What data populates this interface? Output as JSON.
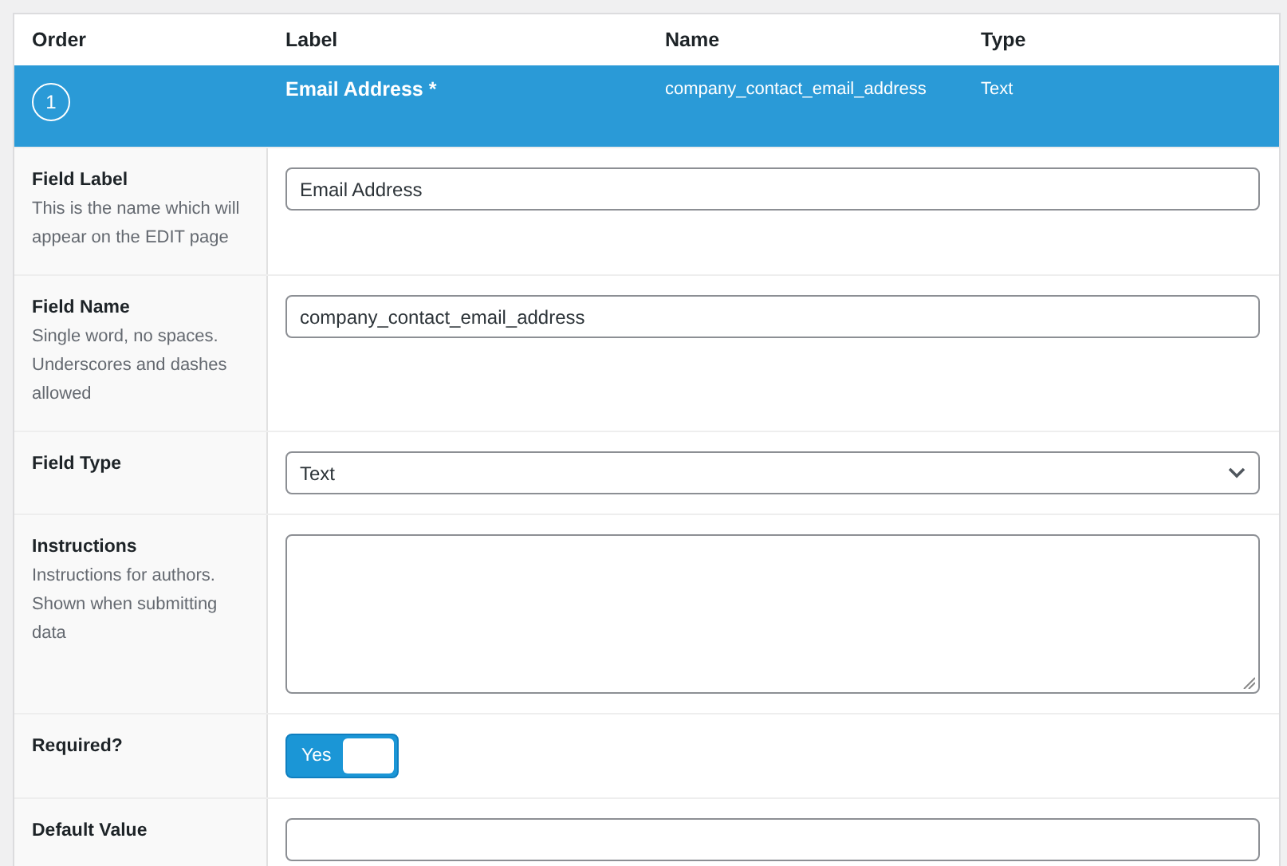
{
  "table": {
    "columns": [
      "Order",
      "Label",
      "Name",
      "Type"
    ],
    "row": {
      "order": "1",
      "label": "Email Address *",
      "name": "company_contact_email_address",
      "type": "Text",
      "selected": true
    }
  },
  "fields": [
    {
      "kind": "text",
      "label": "Field Label",
      "help": "This is the name which will appear on the EDIT page",
      "value": "Email Address"
    },
    {
      "kind": "text",
      "label": "Field Name",
      "help": "Single word, no spaces. Underscores and dashes allowed",
      "value": "company_contact_email_address"
    },
    {
      "kind": "select",
      "label": "Field Type",
      "value": "Text"
    },
    {
      "kind": "textarea",
      "label": "Instructions",
      "help": "Instructions for authors. Shown when submitting data"
    },
    {
      "kind": "toggle",
      "label": "Required?",
      "toggle_label": "Yes",
      "on": true
    },
    {
      "kind": "text",
      "label": "Default Value"
    }
  ]
}
